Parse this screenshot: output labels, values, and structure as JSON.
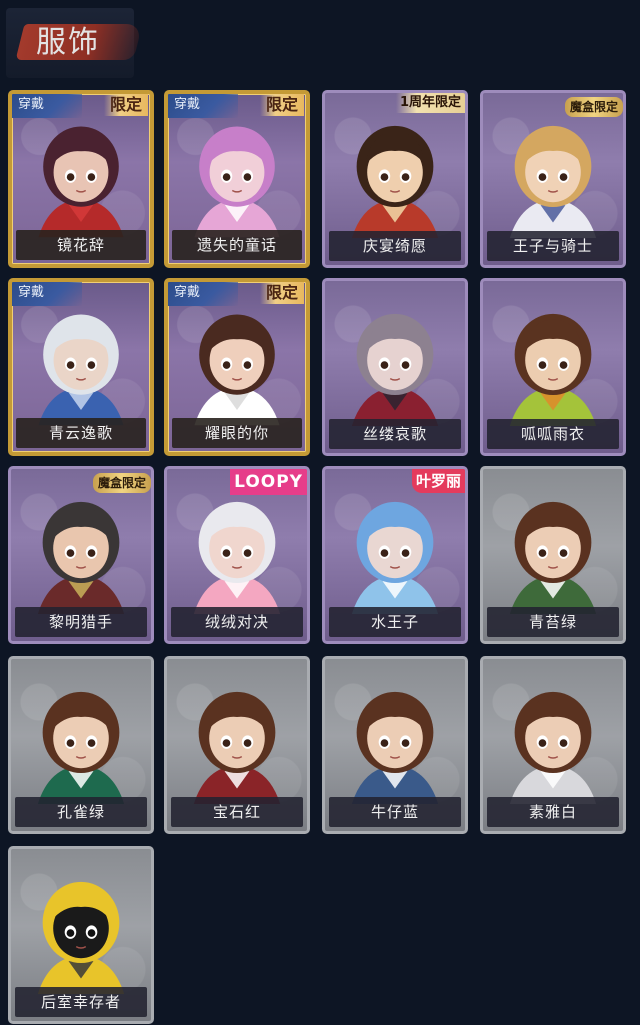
{
  "header": {
    "title": "服饰"
  },
  "costumes": [
    {
      "name": "镜花辞",
      "tier": "gold",
      "badge": "限定",
      "badge_type": "limited",
      "equipped_label": "穿戴",
      "skin": "#e8c4b4",
      "hair": "#4a2230",
      "outfit": "#b52a2a",
      "accent": "#d63a3a"
    },
    {
      "name": "遗失的童话",
      "tier": "gold",
      "badge": "限定",
      "badge_type": "limited",
      "equipped_label": "穿戴",
      "skin": "#f1cfd8",
      "hair": "#c77fc9",
      "outfit": "#e6a6d6",
      "accent": "#ffffff"
    },
    {
      "name": "庆宴绮愿",
      "tier": "purple",
      "badge": "1周年限定",
      "badge_type": "anniv",
      "equipped_label": "",
      "skin": "#efcfae",
      "hair": "#3a2418",
      "outfit": "#b83a2a",
      "accent": "#f2d9a8"
    },
    {
      "name": "王子与骑士",
      "tier": "purple",
      "badge": "魔盒限定",
      "badge_type": "mohe",
      "equipped_label": "",
      "skin": "#f0d2b6",
      "hair": "#d4a760",
      "outfit": "#eaeaf2",
      "accent": "#4a5a9a"
    },
    {
      "name": "青云逸歌",
      "tier": "gold",
      "badge": "",
      "badge_type": "",
      "equipped_label": "穿戴",
      "skin": "#ead5c8",
      "hair": "#dfe4ea",
      "outfit": "#3a62b0",
      "accent": "#c7d6ee"
    },
    {
      "name": "耀眼的你",
      "tier": "gold",
      "badge": "限定",
      "badge_type": "limited",
      "equipped_label": "穿戴",
      "skin": "#efcfbc",
      "hair": "#4a2a20",
      "outfit": "#ffffff",
      "accent": "#d8d8d8"
    },
    {
      "name": "丝缕哀歌",
      "tier": "purple",
      "badge": "",
      "badge_type": "",
      "equipped_label": "",
      "skin": "#e6d2d0",
      "hair": "#8d8190",
      "outfit": "#8a2030",
      "accent": "#2a2430"
    },
    {
      "name": "呱呱雨衣",
      "tier": "purple",
      "badge": "",
      "badge_type": "",
      "equipped_label": "",
      "skin": "#eccdb0",
      "hair": "#5a3320",
      "outfit": "#a4c33a",
      "accent": "#e08a2a"
    },
    {
      "name": "黎明猎手",
      "tier": "purple",
      "badge": "魔盒限定",
      "badge_type": "mohe",
      "equipped_label": "",
      "skin": "#e9c6ae",
      "hair": "#3a3636",
      "outfit": "#6a2a2a",
      "accent": "#c9b15a"
    },
    {
      "name": "绒绒对决",
      "tier": "purple",
      "badge": "LOOPY",
      "badge_type": "loopy",
      "equipped_label": "",
      "skin": "#f0d6ce",
      "hair": "#e9e9ee",
      "outfit": "#f4a7c1",
      "accent": "#ffffff"
    },
    {
      "name": "水王子",
      "tier": "purple",
      "badge": "叶罗丽",
      "badge_type": "zlp",
      "equipped_label": "",
      "skin": "#e9d7d2",
      "hair": "#6ea6e0",
      "outfit": "#8fc3ea",
      "accent": "#ffffff"
    },
    {
      "name": "青苔绿",
      "tier": "gray",
      "badge": "",
      "badge_type": "",
      "equipped_label": "",
      "skin": "#eccdb5",
      "hair": "#5a3220",
      "outfit": "#3e6a3a",
      "accent": "#ffffff"
    },
    {
      "name": "孔雀绿",
      "tier": "gray",
      "badge": "",
      "badge_type": "",
      "equipped_label": "",
      "skin": "#eccdb5",
      "hair": "#5a3220",
      "outfit": "#1e6a4e",
      "accent": "#ffffff"
    },
    {
      "name": "宝石红",
      "tier": "gray",
      "badge": "",
      "badge_type": "",
      "equipped_label": "",
      "skin": "#eccdb5",
      "hair": "#5a3220",
      "outfit": "#8a2428",
      "accent": "#ffffff"
    },
    {
      "name": "牛仔蓝",
      "tier": "gray",
      "badge": "",
      "badge_type": "",
      "equipped_label": "",
      "skin": "#eccdb5",
      "hair": "#5a3220",
      "outfit": "#3a5a8a",
      "accent": "#ffffff"
    },
    {
      "name": "素雅白",
      "tier": "gray",
      "badge": "",
      "badge_type": "",
      "equipped_label": "",
      "skin": "#eccdb5",
      "hair": "#5a3220",
      "outfit": "#d8d8dc",
      "accent": "#ffffff"
    },
    {
      "name": "后室幸存者",
      "tier": "gray",
      "badge": "",
      "badge_type": "",
      "equipped_label": "",
      "skin": "#1a1a1a",
      "hair": "#e8c42a",
      "outfit": "#e8c42a",
      "accent": "#3a3a3a"
    }
  ]
}
